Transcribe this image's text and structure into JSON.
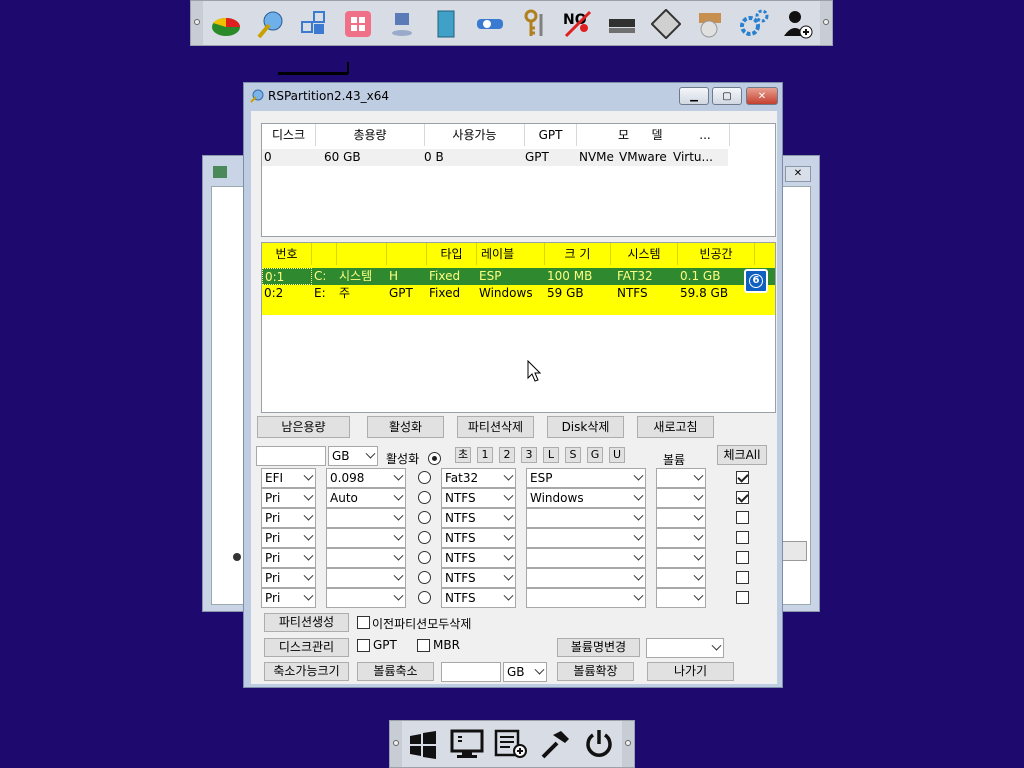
{
  "top_launcher": {
    "icons": [
      "partition-tool-icon",
      "wizard-icon",
      "tiles-icon",
      "windows-store-icon",
      "network-computer-icon",
      "book-icon",
      "network-tool-icon",
      "keys-icon",
      "no-password-icon",
      "drive-icon",
      "floppy-icon",
      "disc-box-icon",
      "gear-icon",
      "add-user-icon"
    ]
  },
  "bottom_launcher": {
    "icons": [
      "windows-start-icon",
      "monitor-icon",
      "list-add-icon",
      "hammer-icon",
      "power-icon"
    ]
  },
  "window": {
    "title": "RSPartition2.43_x64",
    "disk_list": {
      "headers": [
        "디스크",
        "총용량",
        "사용가능",
        "GPT",
        "모",
        "델",
        "..."
      ],
      "rows": [
        [
          "0",
          "60 GB",
          "0 B",
          "GPT",
          "NVMe",
          "VMware",
          "Virtu..."
        ]
      ]
    },
    "partition_list": {
      "headers": [
        "번호",
        "",
        "",
        "",
        "타입",
        "레이블",
        "크 기",
        "시스템",
        "빈공간"
      ],
      "rows": [
        [
          "0:1",
          "C:",
          "시스템",
          "H",
          "Fixed",
          "ESP",
          "100 MB",
          "FAT32",
          "0.1 GB"
        ],
        [
          "0:2",
          "E:",
          "주",
          "GPT",
          "Fixed",
          "Windows",
          "59 GB",
          "NTFS",
          "59.8 GB"
        ]
      ],
      "badge": "6"
    },
    "action_buttons": [
      "남은용량",
      "활성화",
      "파티션삭제",
      "Disk삭제",
      "새로고침"
    ],
    "size_unit": "GB",
    "activate_label": "활성화",
    "letter_buttons": [
      "초",
      "1",
      "2",
      "3",
      "L",
      "S",
      "G",
      "U"
    ],
    "volume_label": "볼륨",
    "check_all": "체크All",
    "partition_rows": [
      {
        "type": "EFI",
        "size": "0.098",
        "fs": "Fat32",
        "label": "ESP",
        "checked": true
      },
      {
        "type": "Pri",
        "size": "Auto",
        "fs": "NTFS",
        "label": "Windows",
        "checked": true
      },
      {
        "type": "Pri",
        "size": "",
        "fs": "NTFS",
        "label": "",
        "checked": false
      },
      {
        "type": "Pri",
        "size": "",
        "fs": "NTFS",
        "label": "",
        "checked": false
      },
      {
        "type": "Pri",
        "size": "",
        "fs": "NTFS",
        "label": "",
        "checked": false
      },
      {
        "type": "Pri",
        "size": "",
        "fs": "NTFS",
        "label": "",
        "checked": false
      },
      {
        "type": "Pri",
        "size": "",
        "fs": "NTFS",
        "label": "",
        "checked": false
      }
    ],
    "create_button": "파티션생성",
    "delete_prev_label": "이전파티션모두삭제",
    "disk_manage_button": "디스크관리",
    "gpt_label": "GPT",
    "mbr_label": "MBR",
    "rename_volume_button": "볼륨명변경",
    "shrinkable_button": "축소가능크기",
    "shrink_button": "볼륨축소",
    "shrink_unit": "GB",
    "extend_button": "볼륨확장",
    "exit_button": "나가기"
  },
  "colors": {
    "desktop": "#1e0a6e",
    "partition_highlight": "#ffff00",
    "selected_row": "#2f8a2f"
  }
}
